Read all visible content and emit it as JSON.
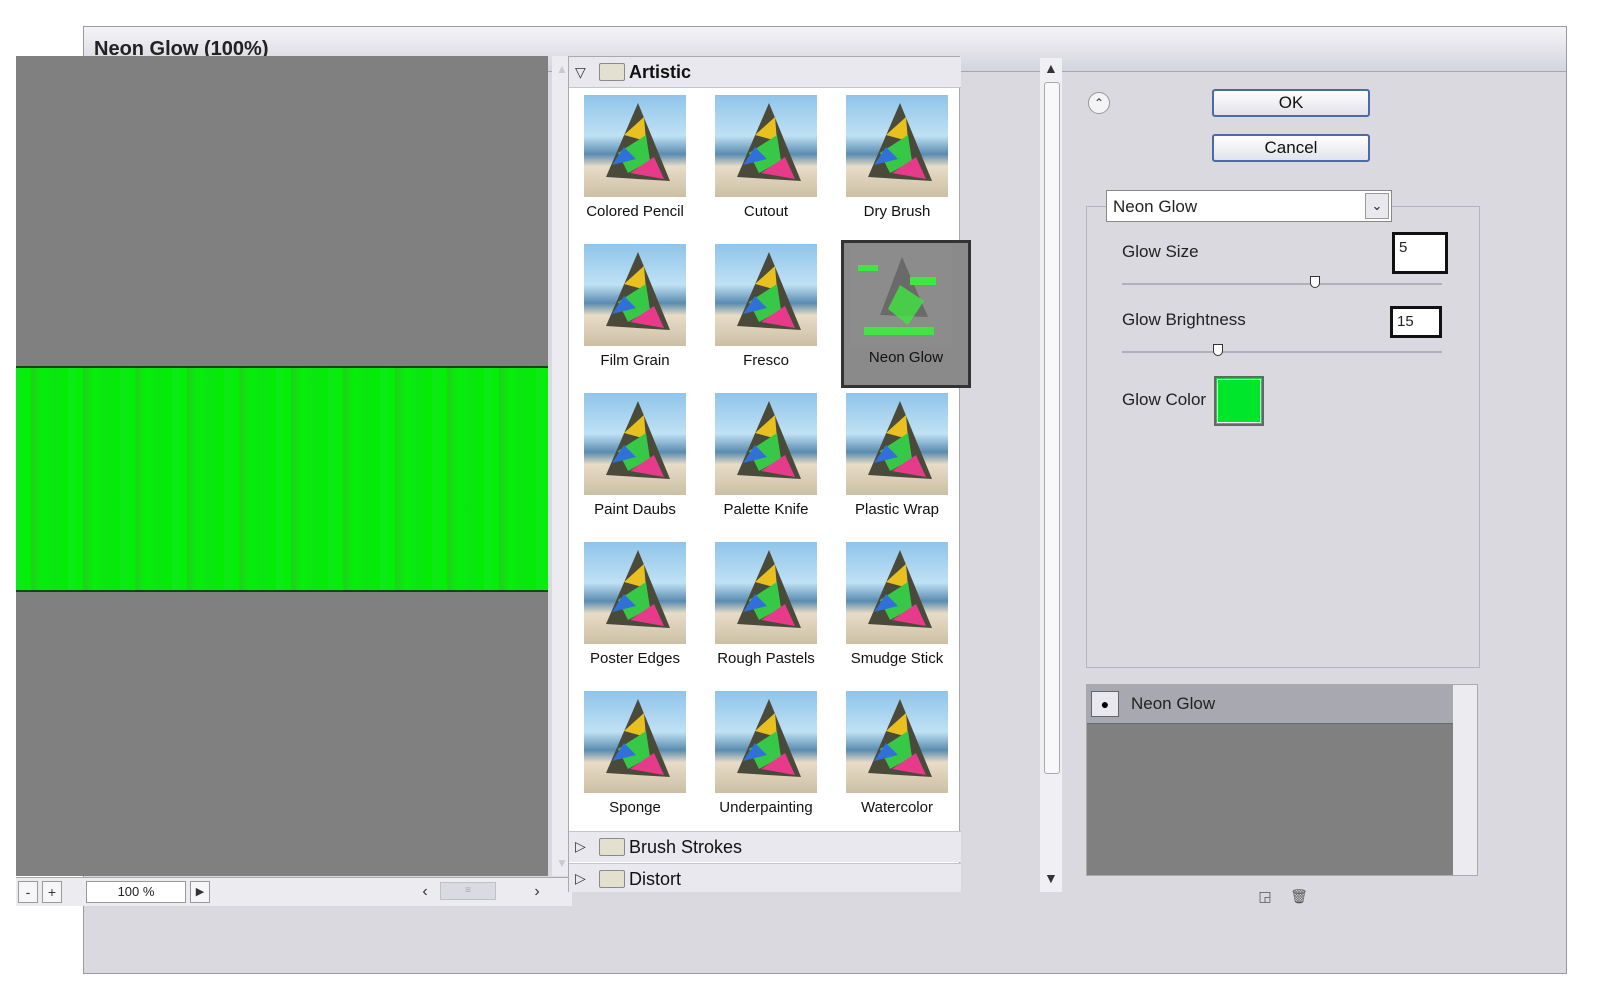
{
  "window": {
    "title": "Neon Glow (100%)"
  },
  "preview": {
    "zoom": "100 %",
    "zoom_minus": "-",
    "zoom_plus": "+"
  },
  "gallery": {
    "category_open": "Artistic",
    "filters": [
      "Colored Pencil",
      "Cutout",
      "Dry Brush",
      "Film Grain",
      "Fresco",
      "Neon Glow",
      "Paint Daubs",
      "Palette Knife",
      "Plastic Wrap",
      "Poster Edges",
      "Rough Pastels",
      "Smudge Stick",
      "Sponge",
      "Underpainting",
      "Watercolor"
    ],
    "selected_filter": "Neon Glow",
    "categories_collapsed": [
      "Brush Strokes",
      "Distort"
    ]
  },
  "buttons": {
    "ok": "OK",
    "cancel": "Cancel"
  },
  "settings": {
    "filter_select": "Neon Glow",
    "glow_size_label": "Glow Size",
    "glow_size_value": "5",
    "glow_brightness_label": "Glow Brightness",
    "glow_brightness_value": "15",
    "glow_color_label": "Glow Color",
    "glow_color": "#00e62a"
  },
  "layers": {
    "items": [
      "Neon Glow"
    ]
  },
  "icons": [
    "collapse-up-icon",
    "eye-icon",
    "folder-icon",
    "new-layer-icon",
    "trash-icon"
  ]
}
